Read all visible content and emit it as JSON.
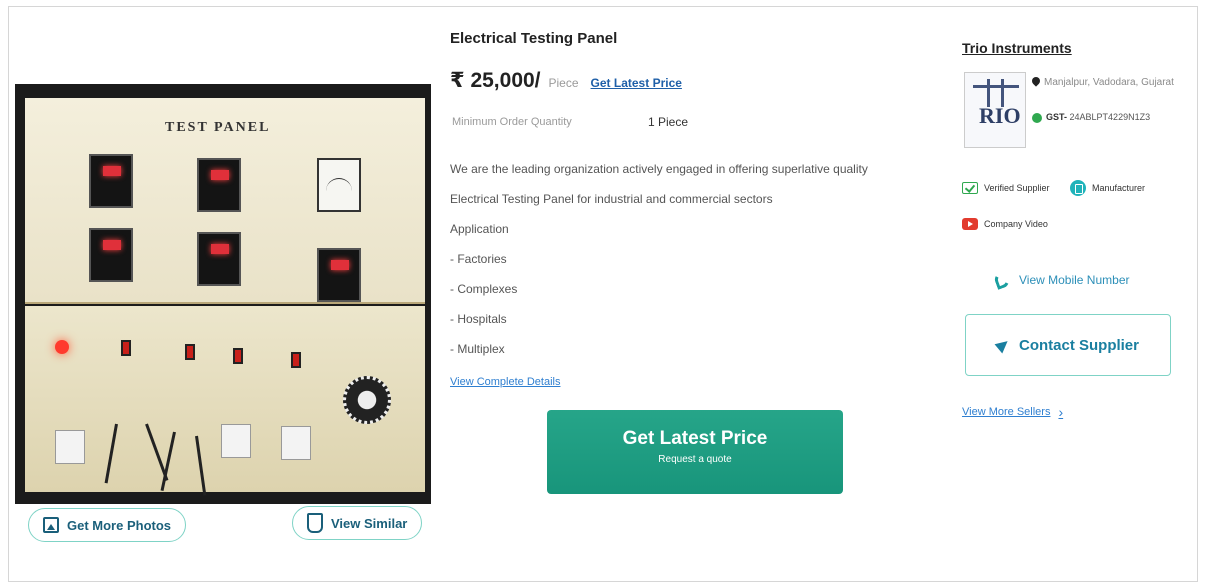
{
  "product": {
    "title": "Electrical Testing Panel",
    "price": "₹ 25,000/",
    "unit": "Piece",
    "latest_price_link": "Get Latest Price",
    "moq_label": "Minimum Order Quantity",
    "moq_value": "1 Piece",
    "description_lines": [
      "We are the leading organization actively engaged in offering superlative quality",
      "Electrical Testing Panel for industrial and commercial sectors",
      "Application",
      "- Factories",
      "- Complexes",
      "- Hospitals",
      "- Multiplex"
    ],
    "details_link": "View Complete Details",
    "image_label": "TEST PANEL"
  },
  "gallery": {
    "more_photos": "Get More Photos",
    "view_similar": "View Similar"
  },
  "cta": {
    "title": "Get Latest Price",
    "subtitle": "Request a quote"
  },
  "supplier": {
    "name": "Trio Instruments",
    "logo_text": "RIO",
    "location": "Manjalpur, Vadodara, Gujarat",
    "gst_label": "GST-",
    "gst_value": "24ABLPT4229N1Z3",
    "badges": {
      "verified": "Verified Supplier",
      "manufacturer": "Manufacturer",
      "video": "Company Video"
    },
    "mobile": "View Mobile Number",
    "contact": "Contact Supplier",
    "more_sellers": "View More Sellers"
  },
  "colors": {
    "accent": "#18957b",
    "link": "#2f7fd0",
    "border": "#7fd3c6"
  }
}
